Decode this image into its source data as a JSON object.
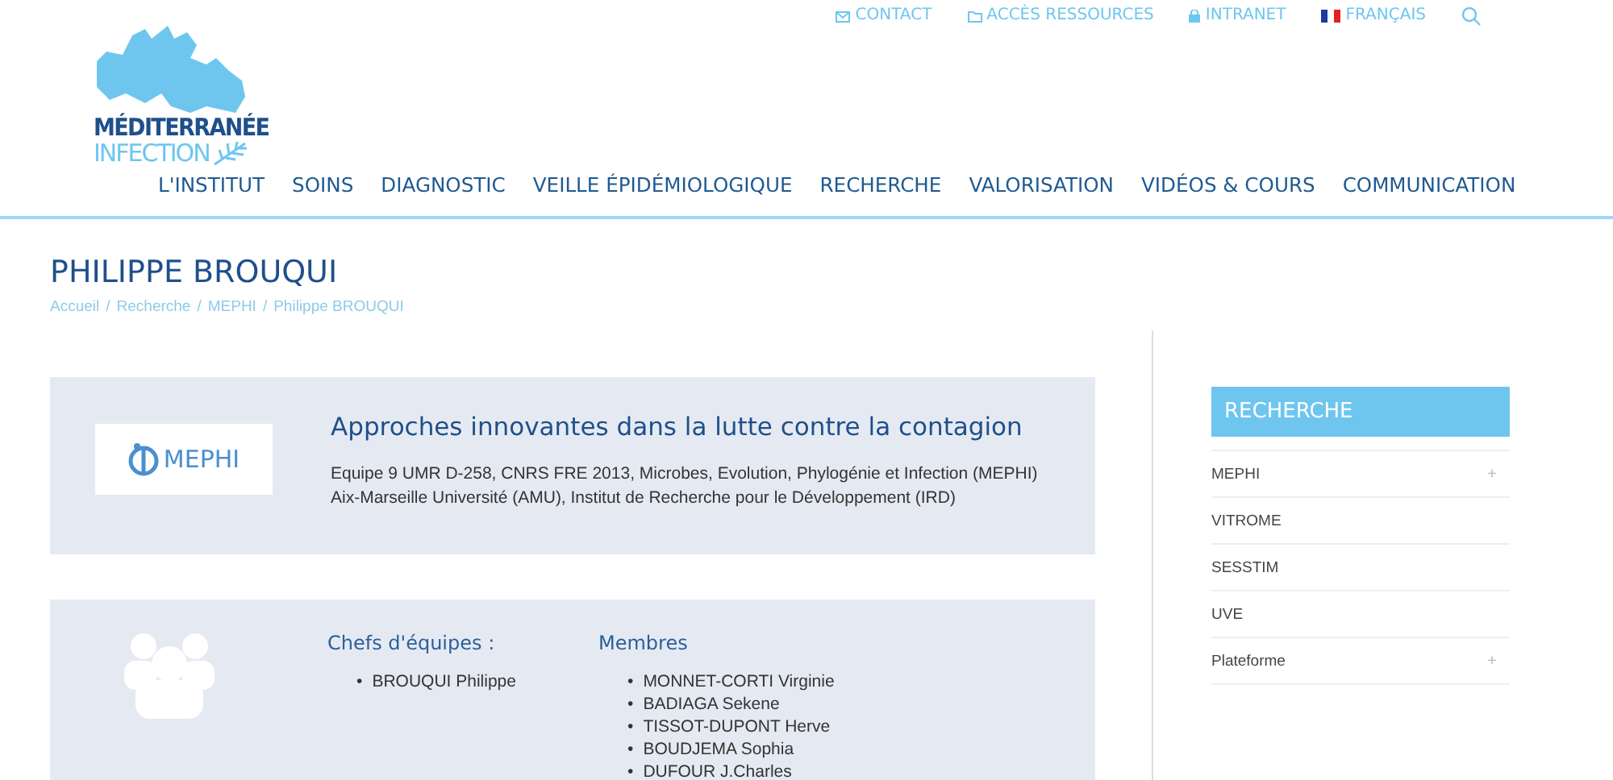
{
  "top_links": [
    {
      "kind": "mail",
      "label": "CONTACT"
    },
    {
      "kind": "folder",
      "label": "ACCÈS RESSOURCES"
    },
    {
      "kind": "lock",
      "label": "INTRANET"
    },
    {
      "kind": "flag",
      "label": "FRANÇAIS"
    }
  ],
  "logo": {
    "line1": "MÉDITERRANÉE",
    "line2": "INFECTION"
  },
  "nav": [
    "L'INSTITUT",
    "SOINS",
    "DIAGNOSTIC",
    "VEILLE ÉPIDÉMIOLOGIQUE",
    "RECHERCHE",
    "VALORISATION",
    "VIDÉOS & COURS",
    "COMMUNICATION"
  ],
  "page_title": "PHILIPPE BROUQUI",
  "breadcrumb": [
    "Accueil",
    "Recherche",
    "MEPHI",
    "Philippe BROUQUI"
  ],
  "breadcrumb_separator": "/",
  "team_card": {
    "logo_text": "MEPHI",
    "title": "Approches innovantes dans la lutte contre la contagion",
    "lines": [
      "Equipe 9 UMR D-258, CNRS FRE 2013, Microbes, Evolution, Phylogénie et Infection (MEPHI)",
      "Aix-Marseille Université (AMU), Institut de Recherche pour le Développement (IRD)"
    ]
  },
  "people": {
    "bullet": "•",
    "chefs_heading": "Chefs d'équipes :",
    "chefs": [
      "BROUQUI Philippe"
    ],
    "members_heading": "Membres",
    "members": [
      "MONNET-CORTI Virginie",
      "BADIAGA Sekene",
      "TISSOT-DUPONT Herve",
      "BOUDJEMA Sophia",
      "DUFOUR J.Charles"
    ]
  },
  "sidebar": {
    "title": "RECHERCHE",
    "items": [
      {
        "label": "MEPHI",
        "expand_icon": "+"
      },
      {
        "label": "VITROME"
      },
      {
        "label": "SESSTIM"
      },
      {
        "label": "UVE"
      },
      {
        "label": "Plateforme",
        "expand_icon": "+"
      }
    ]
  }
}
